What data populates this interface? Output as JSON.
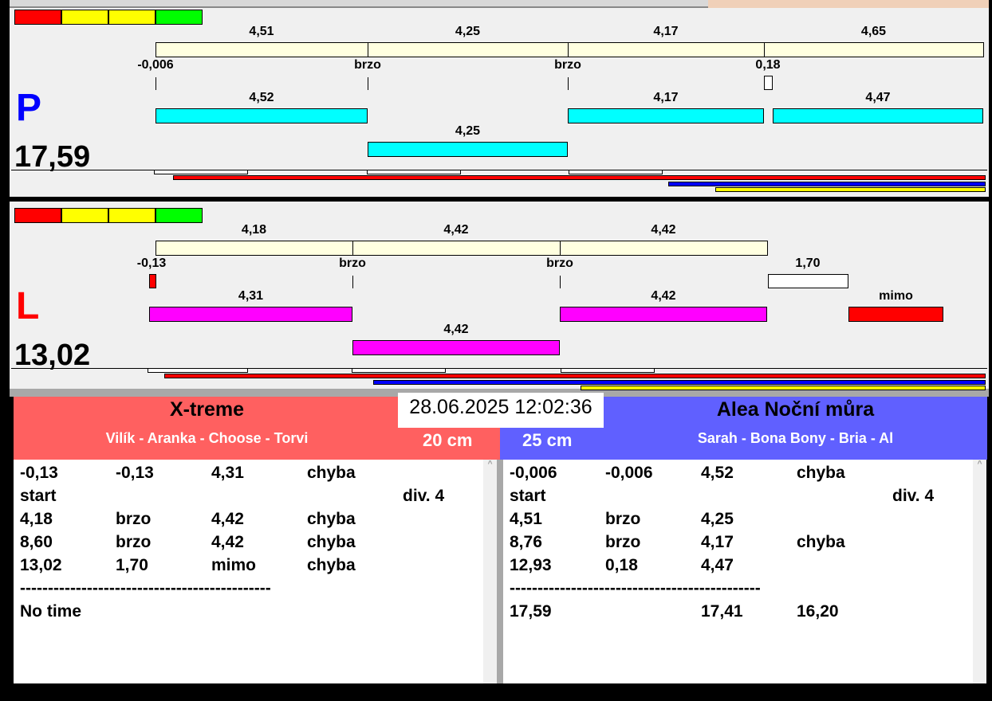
{
  "colors": {
    "red": "#ff0000",
    "yellow": "#ffff00",
    "green": "#00ff00",
    "cream": "#ffffe0",
    "cyan": "#00ffff",
    "magenta": "#ff00ff",
    "left_team": "#ff6060",
    "right_team": "#6060ff"
  },
  "top": {
    "letter": "P",
    "total": "17,59",
    "row1_labels": [
      "4,51",
      "4,25",
      "4,17",
      "4,65"
    ],
    "row2_labels": [
      "-0,006",
      "brzo",
      "brzo",
      "0,18"
    ],
    "row3_labels": [
      "4,52",
      "4,17",
      "4,47"
    ],
    "row4_labels": [
      "4,25"
    ]
  },
  "bottom": {
    "letter": "L",
    "total": "13,02",
    "row1_labels": [
      "4,18",
      "4,42",
      "4,42"
    ],
    "row2_labels": [
      "-0,13",
      "brzo",
      "brzo",
      "1,70"
    ],
    "row3_labels": [
      "4,31",
      "4,42",
      "mimo"
    ],
    "row4_labels": [
      "4,42"
    ]
  },
  "datetime": "28.06.2025 12:02:36",
  "left_team": {
    "name": "X-treme",
    "dogs": "Vilík - Aranka - Choose - Torvi",
    "height": "20 cm",
    "rows": [
      [
        "-0,13",
        "-0,13",
        "4,31",
        "chyba",
        ""
      ],
      [
        "start",
        "",
        "",
        "",
        "div.  4"
      ],
      [
        "4,18",
        "brzo",
        "4,42",
        "chyba",
        ""
      ],
      [
        "8,60",
        "brzo",
        "4,42",
        "chyba",
        ""
      ],
      [
        "13,02",
        "1,70",
        "mimo",
        "chyba",
        ""
      ],
      [
        "---------------------------------------------",
        "",
        "",
        "",
        ""
      ],
      [
        "No time",
        "",
        "",
        "",
        ""
      ]
    ]
  },
  "right_team": {
    "name": "Alea Noční můra",
    "dogs": "Sarah - Bona Bony - Bria - Al",
    "height": "25 cm",
    "rows": [
      [
        "-0,006",
        "-0,006",
        "4,52",
        "chyba",
        ""
      ],
      [
        "start",
        "",
        "",
        "",
        "div.  4"
      ],
      [
        "4,51",
        "brzo",
        "4,25",
        "",
        ""
      ],
      [
        "8,76",
        "brzo",
        "4,17",
        "chyba",
        ""
      ],
      [
        "12,93",
        "0,18",
        "4,47",
        "",
        ""
      ],
      [
        "---------------------------------------------",
        "",
        "",
        "",
        ""
      ],
      [
        "17,59",
        "",
        "17,41",
        "16,20",
        ""
      ]
    ]
  }
}
